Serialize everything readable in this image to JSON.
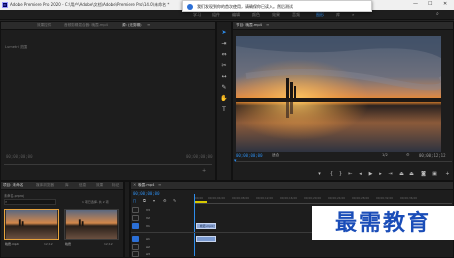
{
  "window": {
    "title": "Adobe Premiere Pro 2020 - C:\\用户\\Adobe\\文档\\Adobe\\Premiere Pro\\14.0\\未命名 *",
    "app_icon": "Pr"
  },
  "workspaces": [
    "学习",
    "组件",
    "编辑",
    "颜色",
    "效果",
    "音频",
    "图形",
    "库",
    "»"
  ],
  "notification": {
    "icon": "info-icon",
    "text": "我们发现到你的首次使用，请确保你已读入。然后测试",
    "accent": "#2b6fd6"
  },
  "source_monitor": {
    "tabs": [
      "Lumetri 范围",
      "效果控件",
      "音频剪辑混合器: 晚霞.mp4",
      "源: (无剪辑)"
    ],
    "tc_in": "00;00;00;00",
    "tc_out": "00;00;00;00"
  },
  "tools": [
    "selection-tool",
    "track-select-tool",
    "ripple-edit-tool",
    "razor-tool",
    "slip-tool",
    "pen-tool",
    "hand-tool",
    "type-tool"
  ],
  "program_monitor": {
    "title": "节目: 晚霞.mp4",
    "timecode": "00;00;00;00",
    "fit_label": "适合",
    "quality": "1/2",
    "duration": "00;00;12;12"
  },
  "project": {
    "tabs": [
      "项目: 未命名",
      "媒体浏览器",
      "库",
      "信息",
      "效果",
      "标记"
    ],
    "path": "未命名.prproj",
    "selected_info": "1 项已选择, 共 2 项",
    "items": [
      {
        "name": "晚霞.mp4",
        "duration": "12;12"
      },
      {
        "name": "晚霞",
        "duration": "12;12"
      }
    ]
  },
  "timeline": {
    "tab": "晚霞.mp4",
    "timecode": "00;00;00;00",
    "ruler": [
      "00;00",
      "00;00;04;00",
      "00;00;08;00",
      "00;00;12;00",
      "00;00;16;00",
      "00;00;20;00",
      "00;00;24;00",
      "00;00;28;00",
      "00;00;32;00",
      "00;00;36;00"
    ],
    "tracks": [
      "V3",
      "V2",
      "V1",
      "A1",
      "A2",
      "A3"
    ],
    "clips": [
      {
        "label": "晚霞.mp4 [V]"
      },
      {
        "label": ""
      }
    ]
  },
  "watermark": "最需教育"
}
